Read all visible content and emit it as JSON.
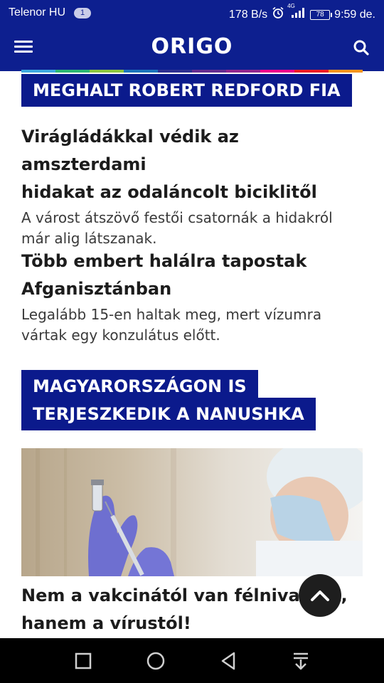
{
  "status_bar": {
    "carrier": "Telenor HU",
    "notification_count": "1",
    "speed": "178 B/s",
    "network": "4G",
    "battery": "78",
    "time": "9:59 de."
  },
  "header": {
    "logo": "ORIGO",
    "menu_icon": "hamburger-menu-icon",
    "search_icon": "search-icon",
    "background": "#0d1f8f"
  },
  "rainbow_colors": [
    "#3fa9e0",
    "#2bb673",
    "#8cc63f",
    "#1c75bc",
    "#2e3192",
    "#662d91",
    "#92278f",
    "#ec008c",
    "#ed1c24",
    "#f7941d"
  ],
  "sections": [
    {
      "title": "MEGHALT ROBERT REDFORD FIA"
    },
    {
      "title_lines": [
        "MAGYARORSZÁGON IS",
        "TERJESZKEDIK A NANUSHKA"
      ]
    }
  ],
  "articles": [
    {
      "headline_lines": [
        "Virágládákkal védik az amszterdami",
        "hidakat az odaláncolt biciklitől"
      ],
      "lead_lines": [
        "A várost átszövő festői csatornák a hidakról",
        "már alig látszanak."
      ]
    },
    {
      "headline_lines": [
        "Több embert halálra tapostak",
        "Afganisztánban"
      ],
      "lead_lines": [
        "Legalább 15-en haltak meg, mert vízumra",
        "vártak egy konzulátus előtt."
      ]
    },
    {
      "headline_lines": [
        "Nem a vakcinától van félnivalónk,",
        "hanem a vírustól!"
      ]
    }
  ],
  "scroll_top_icon": "chevron-up-icon",
  "nav_icons": [
    "square-recent-apps-icon",
    "circle-home-icon",
    "triangle-back-icon",
    "pull-down-notifications-icon"
  ],
  "accent_color": "#0b1a8c"
}
